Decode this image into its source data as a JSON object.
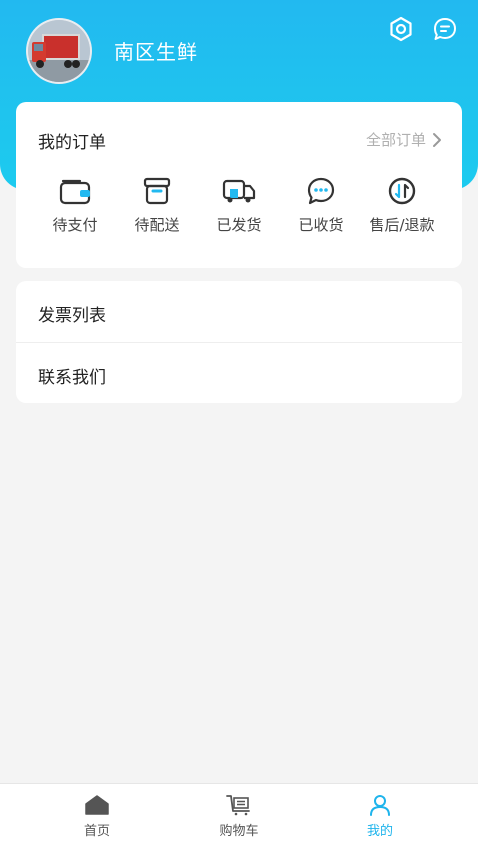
{
  "header": {
    "shop_name": "南区生鲜",
    "icons": [
      "settings-icon",
      "message-icon"
    ],
    "gradient": [
      "#22b9f0",
      "#1ccbef"
    ]
  },
  "orders": {
    "title": "我的订单",
    "all_label": "全部订单",
    "statuses": [
      {
        "label": "待支付",
        "icon": "wallet-icon"
      },
      {
        "label": "待配送",
        "icon": "box-icon"
      },
      {
        "label": "已发货",
        "icon": "truck-icon"
      },
      {
        "label": "已收货",
        "icon": "chat-icon"
      },
      {
        "label": "售后/退款",
        "icon": "refund-icon"
      }
    ]
  },
  "menu": [
    {
      "label": "发票列表"
    },
    {
      "label": "联系我们"
    }
  ],
  "tabbar": {
    "items": [
      {
        "label": "首页",
        "icon": "home-icon",
        "active": false
      },
      {
        "label": "购物车",
        "icon": "cart-icon",
        "active": false
      },
      {
        "label": "我的",
        "icon": "user-icon",
        "active": true
      }
    ],
    "active_color": "#1eb4ec",
    "inactive_color": "#555555"
  }
}
